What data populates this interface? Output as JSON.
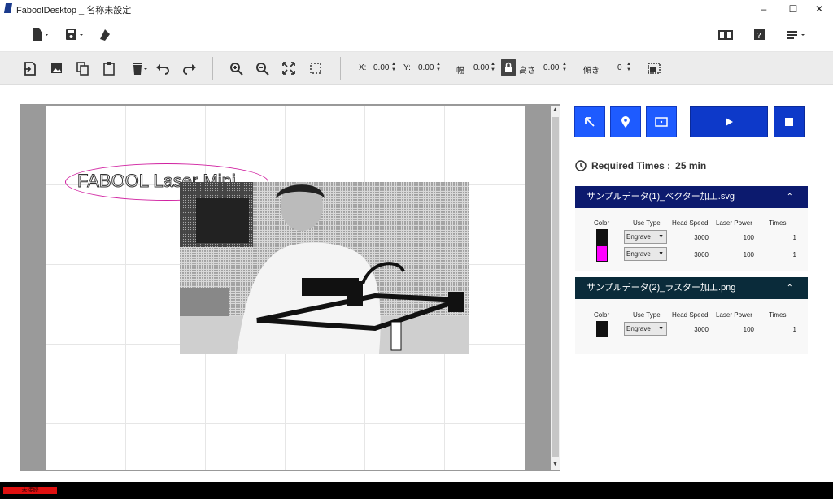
{
  "window": {
    "title": "FaboolDesktop _ 名称未設定"
  },
  "coords": {
    "x_label": "X:",
    "x_value": "0.00",
    "y_label": "Y:",
    "y_value": "0.00",
    "w_label": "幅",
    "w_value": "0.00",
    "h_label": "高さ",
    "h_value": "0.00",
    "angle_label": "傾き",
    "angle_value": "0"
  },
  "canvas": {
    "text_object": "FABOOL Laser Mini"
  },
  "required": {
    "label": "Required Times :",
    "value": "25 min"
  },
  "layers": [
    {
      "name": "サンプルデータ(1)_ベクター加工.svg",
      "headers": {
        "color": "Color",
        "use_type": "Use Type",
        "speed": "Head Speed",
        "power": "Laser Power",
        "times": "Times"
      },
      "rows": [
        {
          "color": "#111111",
          "use_type": "Engrave",
          "speed": "3000",
          "power": "100",
          "times": "1"
        },
        {
          "color": "#ff00ff",
          "use_type": "Engrave",
          "speed": "3000",
          "power": "100",
          "times": "1"
        }
      ]
    },
    {
      "name": "サンプルデータ(2)_ラスター加工.png",
      "headers": {
        "color": "Color",
        "use_type": "Use Type",
        "speed": "Head Speed",
        "power": "Laser Power",
        "times": "Times"
      },
      "rows": [
        {
          "color": "#111111",
          "use_type": "Engrave",
          "speed": "3000",
          "power": "100",
          "times": "1"
        }
      ]
    }
  ],
  "status": {
    "connection": "未接続"
  },
  "colors": {
    "accent": "#1e5bff",
    "layer1_header": "#0c1a6e",
    "layer2_header": "#0a2b3a",
    "status_red": "#e01010"
  }
}
